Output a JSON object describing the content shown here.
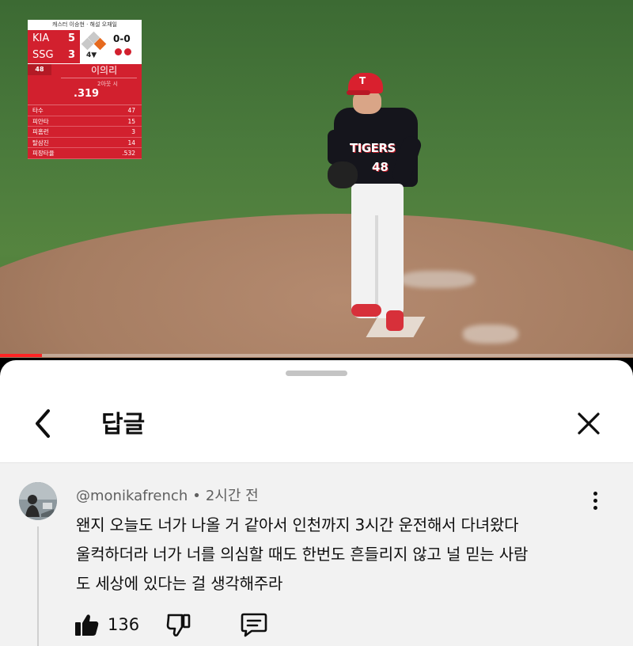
{
  "scoreboard": {
    "broadcast_credits": "캐스터 이승현 · 해설 오재일",
    "teams": [
      {
        "name": "KIA",
        "runs": "5"
      },
      {
        "name": "SSG",
        "runs": "3"
      }
    ],
    "inning": "4▼",
    "count": "0-0",
    "outs": 2,
    "player_number": "48",
    "player_name": "이의리",
    "situation": "2아웃 시",
    "avg": ".319",
    "stats": [
      {
        "label": "타수",
        "value": "47"
      },
      {
        "label": "피안타",
        "value": "15"
      },
      {
        "label": "피홈런",
        "value": "3"
      },
      {
        "label": "탈삼진",
        "value": "14"
      },
      {
        "label": "피장타율",
        "value": ".532"
      }
    ]
  },
  "player": {
    "jersey_text": "TIGERS",
    "jersey_number": "48",
    "cap_logo": "T"
  },
  "video": {
    "progress_fraction": 0.066
  },
  "sheet": {
    "title": "답글"
  },
  "comment": {
    "author": "@monikafrench",
    "separator": "•",
    "time": "2시간 전",
    "lines": [
      "왠지 오늘도 너가 나올 거 같아서 인천까지 3시간 운전해서 다녀왔다",
      "울컥하더라 너가 너를 의심할 때도 한번도 흔들리지 않고 널 믿는 사람",
      "도 세상에 있다는 걸 생각해주라"
    ],
    "like_count": "136"
  },
  "icons": {
    "back": "chevron-left-icon",
    "close": "close-icon",
    "more": "more-vertical-icon",
    "like": "thumbs-up-icon",
    "dislike": "thumbs-down-icon",
    "reply": "reply-icon"
  },
  "colors": {
    "kia_red": "#d2202e",
    "progress_red": "#ff2424"
  }
}
